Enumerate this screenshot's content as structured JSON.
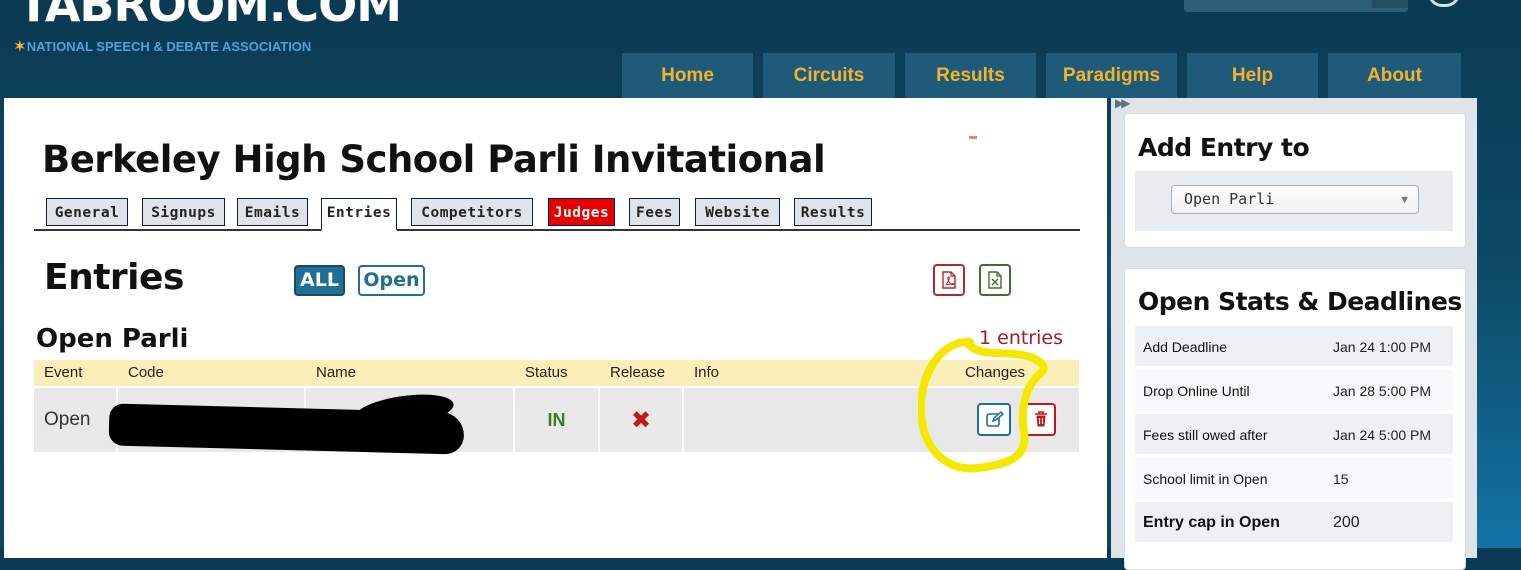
{
  "site": {
    "logo": "TABROOM.COM",
    "association": "NATIONAL SPEECH & DEBATE ASSOCIATION"
  },
  "nav": [
    "Home",
    "Circuits",
    "Results",
    "Paradigms",
    "Help",
    "About"
  ],
  "tournament": {
    "title": "Berkeley High School Parli Invitational"
  },
  "tabs": [
    {
      "label": "General"
    },
    {
      "label": "Signups"
    },
    {
      "label": "Emails"
    },
    {
      "label": "Entries",
      "state": "active"
    },
    {
      "label": "Competitors"
    },
    {
      "label": "Judges",
      "state": "alert"
    },
    {
      "label": "Fees"
    },
    {
      "label": "Website"
    },
    {
      "label": "Results"
    }
  ],
  "entries": {
    "heading": "Entries",
    "filters": [
      "ALL",
      "Open"
    ],
    "event_name": "Open Parli",
    "count_label": "1 entries",
    "columns": [
      "Event",
      "Code",
      "Name",
      "Status",
      "Release",
      "Info",
      "Changes"
    ],
    "rows": [
      {
        "event": "Open",
        "status": "IN",
        "release": "✖"
      }
    ],
    "icons": {
      "pdf": "pdf-file-icon",
      "excel": "excel-file-icon",
      "edit": "edit-icon",
      "delete": "trash-icon"
    }
  },
  "sidebar": {
    "add_entry": {
      "title": "Add Entry to",
      "selected": "Open Parli"
    },
    "stats": {
      "title": "Open Stats & Deadlines",
      "rows": [
        {
          "label": "Add Deadline",
          "value": "Jan 24 1:00 PM"
        },
        {
          "label": "Drop Online Until",
          "value": "Jan 28 5:00 PM"
        },
        {
          "label": "Fees still owed after",
          "value": "Jan 24 5:00 PM"
        },
        {
          "label": "School limit in Open",
          "value": "15"
        },
        {
          "label": "Entry cap in Open",
          "value": "200"
        }
      ]
    }
  },
  "colors": {
    "header_bg": "#0e4a66",
    "nav_text": "#f3b32c",
    "accent": "#1f6f96",
    "alert": "#e60000",
    "table_header": "#fbeeb8",
    "annotation": "#f5e800"
  }
}
